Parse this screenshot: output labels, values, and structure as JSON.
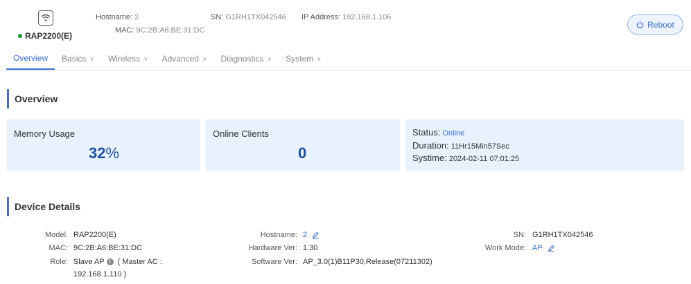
{
  "device": {
    "name": "RAP2200(E)",
    "hostname_label": "Hostname:",
    "hostname": "2",
    "mac_label": "MAC:",
    "mac": "9C:2B:A6:BE:31:DC",
    "sn_label": "SN:",
    "sn": "G1RH1TX042546",
    "ip_label": "IP Address:",
    "ip": "192.168.1.106",
    "status_color": "#1a9b3b"
  },
  "header": {
    "reboot_label": "Reboot"
  },
  "nav": {
    "items": [
      {
        "label": "Overview",
        "active": true
      },
      {
        "label": "Basics",
        "chevron": true
      },
      {
        "label": "Wireless",
        "chevron": true
      },
      {
        "label": "Advanced",
        "chevron": true
      },
      {
        "label": "Diagnostics",
        "chevron": true
      },
      {
        "label": "System",
        "chevron": true
      }
    ],
    "chevron_glyph": "∨"
  },
  "overview": {
    "title": "Overview",
    "memory": {
      "label": "Memory Usage",
      "value": "32",
      "unit": "%"
    },
    "clients": {
      "label": "Online Clients",
      "value": "0"
    },
    "status": {
      "status_label": "Status:",
      "status_value": "Online",
      "duration_label": "Duration:",
      "duration_value": "11Hr15Min57Sec",
      "systime_label": "Systime:",
      "systime_value": "2024-02-11 07:01:25"
    }
  },
  "details": {
    "title": "Device Details",
    "model_label": "Model:",
    "model": "RAP2200(E)",
    "mac_label": "MAC:",
    "mac": "9C:2B:A6:BE:31:DC",
    "role_label": "Role:",
    "role": "Slave AP",
    "master_prefix": "( Master AC :",
    "master_ip": "192.168.1.110 )",
    "hostname_label": "Hostname:",
    "hostname": "2",
    "hw_label": "Hardware Ver:",
    "hw": "1.30",
    "sw_label": "Software Ver:",
    "sw": "AP_3.0(1)B11P30,Release(07211302)",
    "sn_label": "SN:",
    "sn": "G1RH1TX042546",
    "workmode_label": "Work Mode:",
    "workmode": "AP"
  },
  "colors": {
    "accent": "#3a6fcf",
    "card_bg": "#e8f2fc",
    "value_blue": "#1e4e9e",
    "section_bar": "#4b6fa8"
  }
}
